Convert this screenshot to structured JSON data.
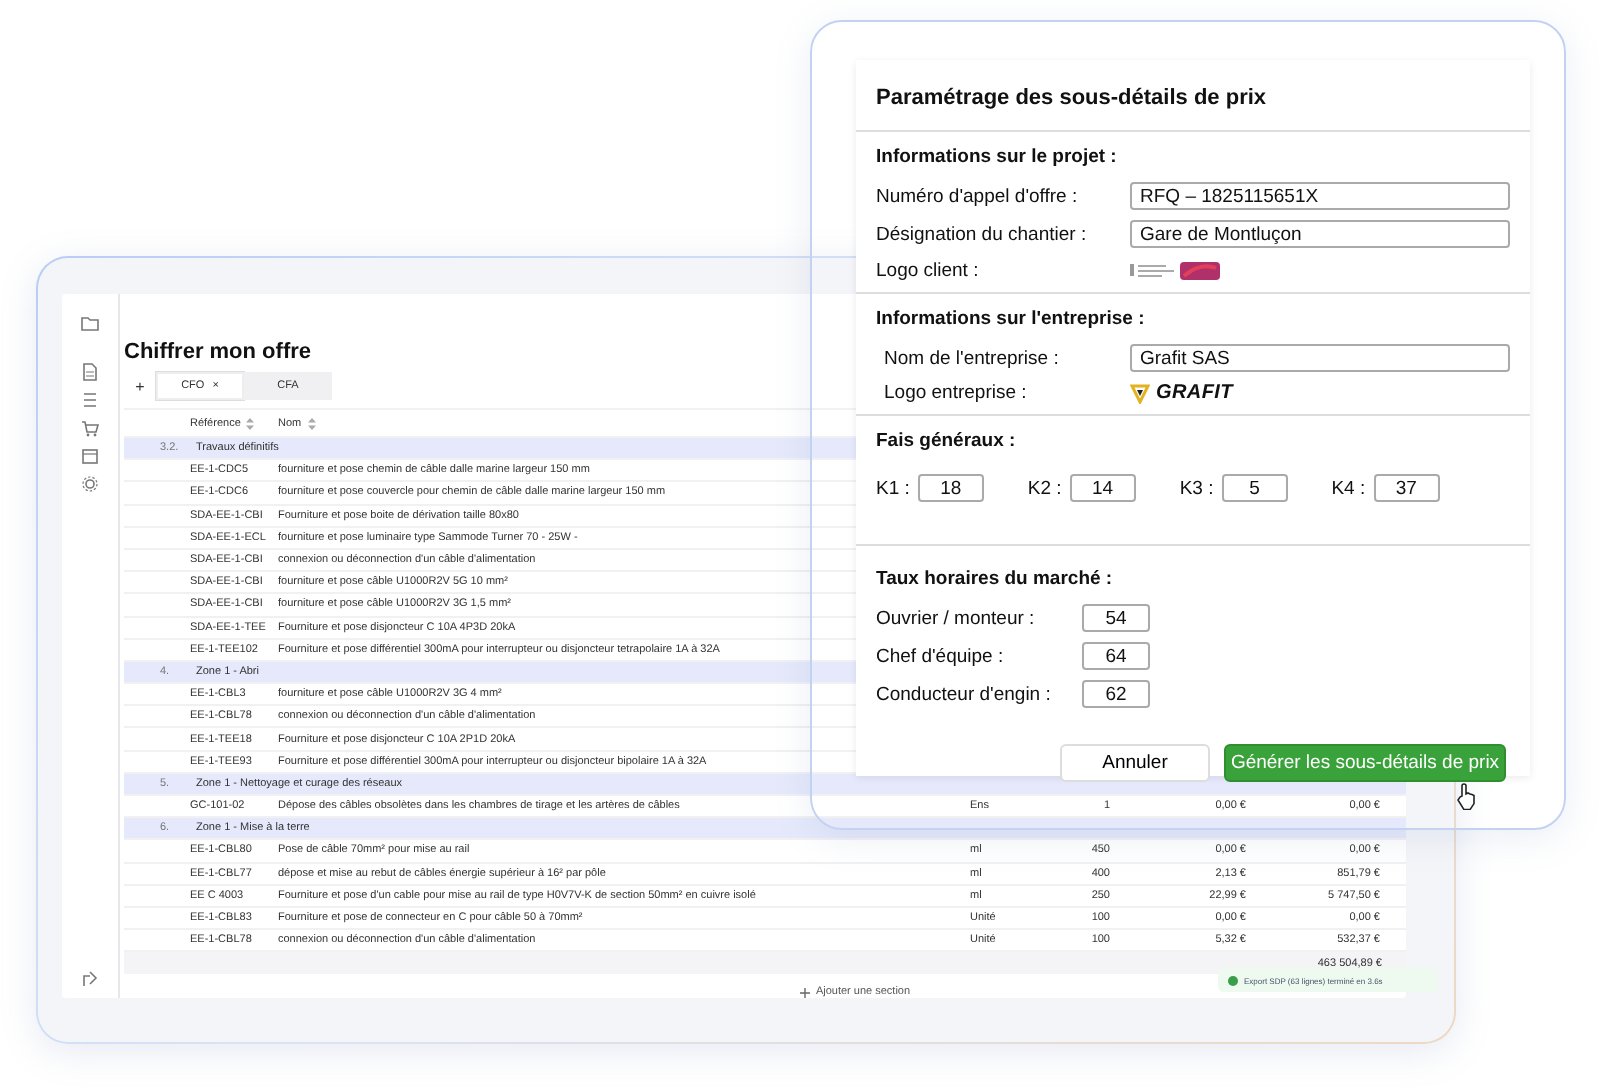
{
  "offer": {
    "title": "Chiffrer mon offre",
    "add_tab": "+",
    "tabs": [
      {
        "label": "CFO",
        "close": "×",
        "selected": true
      },
      {
        "label": "CFA",
        "selected": false
      }
    ],
    "columns": [
      "Référence",
      "Nom"
    ],
    "rows": [
      {
        "kind": "section",
        "number": "3.2.",
        "label": "Travaux définitifs"
      },
      {
        "kind": "item",
        "ref": "EE-1-CDC5",
        "name": "fourniture et pose chemin de câble dalle marine largeur 150 mm"
      },
      {
        "kind": "item",
        "ref": "EE-1-CDC6",
        "name": "fourniture et pose couvercle pour chemin de câble dalle marine largeur 150 mm"
      },
      {
        "kind": "item",
        "ref": "SDA-EE-1-CBI",
        "name": "Fourniture et pose boite de dérivation taille 80x80"
      },
      {
        "kind": "item",
        "ref": "SDA-EE-1-ECL",
        "name": "fourniture et pose luminaire type Sammode Turner 70 - 25W -"
      },
      {
        "kind": "item",
        "ref": "SDA-EE-1-CBI",
        "name": "connexion ou déconnection d'un câble d'alimentation"
      },
      {
        "kind": "item",
        "ref": "SDA-EE-1-CBI",
        "name": "fourniture et pose câble U1000R2V 5G 10 mm²"
      },
      {
        "kind": "item",
        "ref": "SDA-EE-1-CBI",
        "name": "fourniture et pose câble U1000R2V 3G 1,5 mm²"
      },
      {
        "kind": "item",
        "ref": "SDA-EE-1-TEE",
        "name": "Fourniture et pose disjoncteur C 10A 4P3D 20kA"
      },
      {
        "kind": "item",
        "ref": "EE-1-TEE102",
        "name": "Fourniture et pose différentiel 300mA pour interrupteur ou disjoncteur tetrapolaire 1A à 32A"
      },
      {
        "kind": "section",
        "number": "4.",
        "label": "Zone 1 - Abri"
      },
      {
        "kind": "item",
        "ref": "EE-1-CBL3",
        "name": "fourniture et pose câble U1000R2V 3G 4 mm²"
      },
      {
        "kind": "item",
        "ref": "EE-1-CBL78",
        "name": "connexion ou déconnection d'un câble d'alimentation"
      },
      {
        "kind": "item",
        "ref": "EE-1-TEE18",
        "name": "Fourniture et pose disjoncteur C 10A 2P1D 20kA"
      },
      {
        "kind": "item",
        "ref": "EE-1-TEE93",
        "name": "Fourniture et pose différentiel 300mA pour interrupteur ou disjoncteur bipolaire 1A à 32A"
      },
      {
        "kind": "section",
        "number": "5.",
        "label": "Zone 1 - Nettoyage et curage des réseaux"
      },
      {
        "kind": "item",
        "ref": "GC-101-02",
        "name": "Dépose des câbles obsolètes dans les chambres de tirage et les artères de câbles",
        "unit": "Ens",
        "qty": "1",
        "price": "0,00 €",
        "total": "0,00 €"
      },
      {
        "kind": "section",
        "number": "6.",
        "label": "Zone 1 - Mise à la terre"
      },
      {
        "kind": "item",
        "ref": "EE-1-CBL80",
        "name": "Pose de câble 70mm² pour mise au rail",
        "unit": "ml",
        "qty": "450",
        "price": "0,00 €",
        "total": "0,00 €"
      },
      {
        "kind": "item",
        "ref": "EE-1-CBL77",
        "name": "dépose et mise au rebut de câbles énergie supérieur à 16² par pôle",
        "unit": "ml",
        "qty": "400",
        "price": "2,13 €",
        "total": "851,79 €"
      },
      {
        "kind": "item",
        "ref": "EE C 4003",
        "name": "Fourniture et pose d'un cable pour mise au rail de type H0V7V-K de section 50mm² en cuivre isolé",
        "unit": "ml",
        "qty": "250",
        "price": "22,99 €",
        "total": "5 747,50 €"
      },
      {
        "kind": "item",
        "ref": "EE-1-CBL83",
        "name": "Fourniture et pose de connecteur en C pour câble 50 à 70mm²",
        "unit": "Unité",
        "qty": "100",
        "price": "0,00 €",
        "total": "0,00 €"
      },
      {
        "kind": "item",
        "ref": "EE-1-CBL78",
        "name": "connexion ou déconnection d'un câble d'alimentation",
        "unit": "Unité",
        "qty": "100",
        "price": "5,32 €",
        "total": "532,37 €"
      }
    ],
    "grand_total": "463 504,89 €",
    "add_section": "Ajouter une section",
    "toast": "Export SDP (63 lignes) terminé en 3.6s"
  },
  "dialog": {
    "title": "Paramétrage des sous-détails de prix",
    "project": {
      "heading": "Informations sur le projet :",
      "fields": [
        {
          "label": "Numéro d'appel d'offre :",
          "value": "RFQ – 1825115651X"
        },
        {
          "label": "Désignation du chantier :",
          "value": "Gare de Montluçon"
        }
      ],
      "logo_label": "Logo client :"
    },
    "company": {
      "heading": "Informations sur l'entreprise :",
      "fields": [
        {
          "label": "Nom de l'entreprise :",
          "value": "Grafit SAS"
        }
      ],
      "logo_label": "Logo entreprise :",
      "logo_text": "GRAFIT"
    },
    "fees": {
      "heading": "Fais généraux :",
      "items": [
        {
          "label": "K1 :",
          "value": "18"
        },
        {
          "label": "K2 :",
          "value": "14"
        },
        {
          "label": "K3 :",
          "value": "5"
        },
        {
          "label": "K4 :",
          "value": "37"
        }
      ]
    },
    "rates": {
      "heading": "Taux horaires du marché :",
      "items": [
        {
          "label": "Ouvrier / monteur :",
          "value": "54"
        },
        {
          "label": "Chef d'équipe :",
          "value": "64"
        },
        {
          "label": "Conducteur d'engin :",
          "value": "62"
        }
      ]
    },
    "cancel": "Annuler",
    "submit": "Générer les sous-détails de prix"
  }
}
